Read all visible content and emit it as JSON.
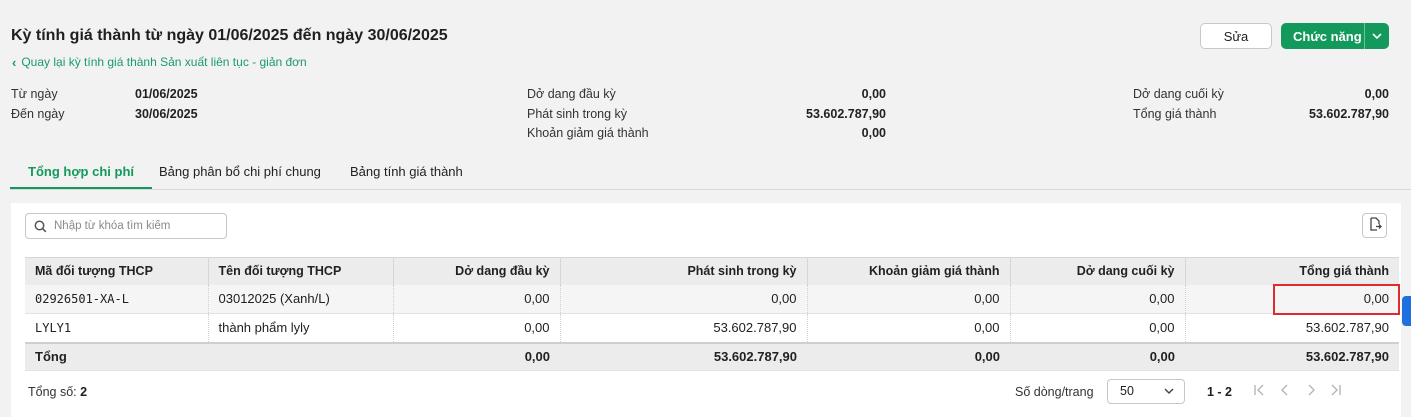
{
  "header": {
    "title": "Kỳ tính giá thành từ ngày 01/06/2025 đến ngày 30/06/2025",
    "back_link": "Quay lại kỳ tính giá thành Sản xuất liên tục - giản đơn",
    "edit_label": "Sửa",
    "function_label": "Chức năng"
  },
  "info": {
    "from_label": "Từ ngày",
    "from_value": "01/06/2025",
    "to_label": "Đến ngày",
    "to_value": "30/06/2025",
    "wip_begin_label": "Dở dang đầu kỳ",
    "wip_begin_value": "0,00",
    "incurred_label": "Phát sinh trong kỳ",
    "incurred_value": "53.602.787,90",
    "reduction_label": "Khoản giảm giá thành",
    "reduction_value": "0,00",
    "wip_end_label": "Dở dang cuối kỳ",
    "wip_end_value": "0,00",
    "total_cost_label": "Tổng giá thành",
    "total_cost_value": "53.602.787,90"
  },
  "tabs": [
    {
      "label": "Tổng hợp chi phí",
      "active": true
    },
    {
      "label": "Bảng phân bổ chi phí chung",
      "active": false
    },
    {
      "label": "Bảng tính giá thành",
      "active": false
    }
  ],
  "search": {
    "placeholder": "Nhập từ khóa tìm kiếm"
  },
  "table": {
    "columns": [
      "Mã đối tượng THCP",
      "Tên đối tượng THCP",
      "Dở dang đầu kỳ",
      "Phát sinh trong kỳ",
      "Khoản giảm giá thành",
      "Dở dang cuối kỳ",
      "Tổng giá thành"
    ],
    "rows": [
      [
        "02926501-XA-L",
        "03012025 (Xanh/L)",
        "0,00",
        "0,00",
        "0,00",
        "0,00",
        "0,00"
      ],
      [
        "LYLY1",
        "thành phẩm lyly",
        "0,00",
        "53.602.787,90",
        "0,00",
        "0,00",
        "53.602.787,90"
      ]
    ],
    "total": [
      "Tổng",
      "",
      "0,00",
      "53.602.787,90",
      "0,00",
      "0,00",
      "53.602.787,90"
    ]
  },
  "footer": {
    "total_label": "Tổng số:",
    "total_count": "2",
    "rows_per_page_label": "Số dòng/trang",
    "rows_per_page": "50",
    "range": "1 - 2"
  },
  "colors": {
    "accent": "#13995b",
    "highlight": "#e02b2b",
    "side_tab": "#1e6fe0"
  }
}
